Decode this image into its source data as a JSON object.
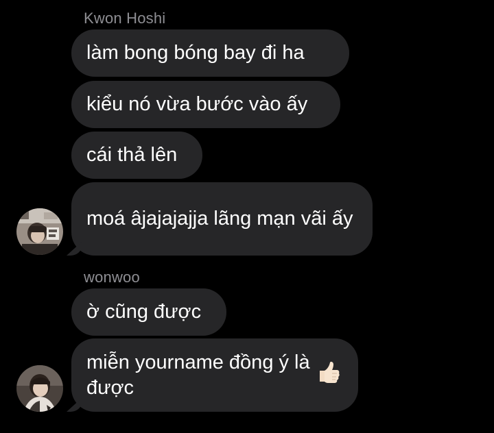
{
  "thread": {
    "groups": [
      {
        "sender": "Kwon Hoshi",
        "messages": [
          "làm bong bóng bay đi ha",
          "kiểu nó vừa bước vào ấy",
          "cái thả lên",
          "moá âjajajajja lãng mạn vãi ấy"
        ]
      },
      {
        "sender": "wonwoo",
        "messages": [
          "ờ cũng được",
          "miễn yourname đồng ý là được"
        ]
      }
    ]
  },
  "emoji": {
    "thumbs_up": "thumbs-up-icon"
  },
  "colors": {
    "background": "#000000",
    "bubble": "#262628",
    "sender_name": "#8e8e93",
    "text": "#ffffff"
  }
}
